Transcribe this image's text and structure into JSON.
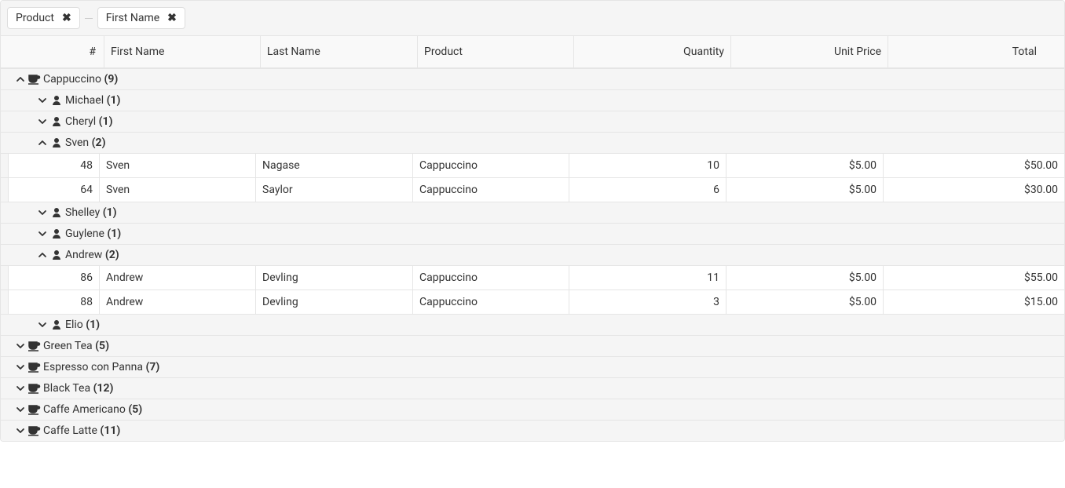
{
  "groupPanel": {
    "chips": [
      {
        "label": "Product"
      },
      {
        "label": "First Name"
      }
    ]
  },
  "columns": {
    "num": "#",
    "firstName": "First Name",
    "lastName": "Last Name",
    "product": "Product",
    "quantity": "Quantity",
    "unitPrice": "Unit Price",
    "total": "Total"
  },
  "groups": {
    "cappuccino": {
      "label": "Cappuccino",
      "count": "(9)"
    },
    "michael": {
      "label": "Michael",
      "count": "(1)"
    },
    "cheryl": {
      "label": "Cheryl",
      "count": "(1)"
    },
    "sven": {
      "label": "Sven",
      "count": "(2)"
    },
    "shelley": {
      "label": "Shelley",
      "count": "(1)"
    },
    "guylene": {
      "label": "Guylene",
      "count": "(1)"
    },
    "andrew": {
      "label": "Andrew",
      "count": "(2)"
    },
    "elio": {
      "label": "Elio",
      "count": "(1)"
    },
    "greenTea": {
      "label": "Green Tea",
      "count": "(5)"
    },
    "espresso": {
      "label": "Espresso con Panna",
      "count": "(7)"
    },
    "blackTea": {
      "label": "Black Tea",
      "count": "(12)"
    },
    "americano": {
      "label": "Caffe Americano",
      "count": "(5)"
    },
    "latte": {
      "label": "Caffe Latte",
      "count": "(11)"
    }
  },
  "rows": {
    "r48": {
      "num": "48",
      "fn": "Sven",
      "ln": "Nagase",
      "prod": "Cappuccino",
      "qty": "10",
      "price": "$5.00",
      "total": "$50.00"
    },
    "r64": {
      "num": "64",
      "fn": "Sven",
      "ln": "Saylor",
      "prod": "Cappuccino",
      "qty": "6",
      "price": "$5.00",
      "total": "$30.00"
    },
    "r86": {
      "num": "86",
      "fn": "Andrew",
      "ln": "Devling",
      "prod": "Cappuccino",
      "qty": "11",
      "price": "$5.00",
      "total": "$55.00"
    },
    "r88": {
      "num": "88",
      "fn": "Andrew",
      "ln": "Devling",
      "prod": "Cappuccino",
      "qty": "3",
      "price": "$5.00",
      "total": "$15.00"
    }
  }
}
